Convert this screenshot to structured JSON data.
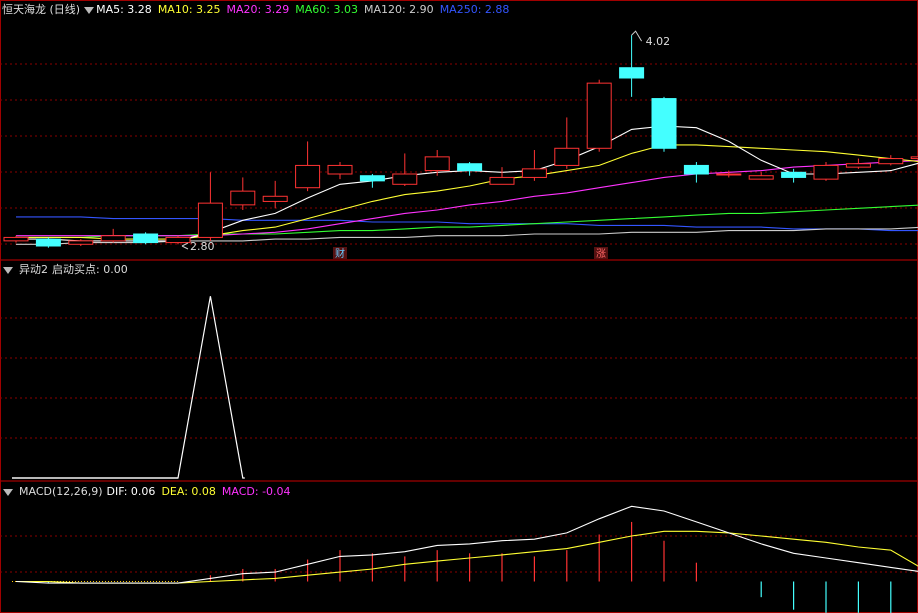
{
  "main": {
    "title": "恒天海龙 (日线)",
    "ma": [
      {
        "label": "MA5: 3.28",
        "color": "#ffffff"
      },
      {
        "label": "MA10: 3.25",
        "color": "#ffff33"
      },
      {
        "label": "MA20: 3.29",
        "color": "#ff33ff"
      },
      {
        "label": "MA60: 3.03",
        "color": "#33ff33"
      },
      {
        "label": "MA120: 2.90",
        "color": "#cccccc"
      },
      {
        "label": "MA250: 2.88",
        "color": "#3355ff"
      }
    ],
    "high_label": "4.02",
    "low_label": "2.80",
    "marker_cai": "财",
    "marker_zhang": "涨"
  },
  "pane2": {
    "title": "异动2",
    "value_label": "启动买点: 0.00"
  },
  "pane3": {
    "title": "MACD(12,26,9)",
    "dif": "DIF: 0.06",
    "dea": "DEA: 0.08",
    "macd": "MACD: -0.04"
  },
  "colors": {
    "up": "#ff3333",
    "down": "#44ffff",
    "grid": "#8a0000",
    "border": "#a00000"
  },
  "chart_data": [
    {
      "type": "candlestick",
      "title": "恒天海龙 (日线)",
      "ylim": [
        2.72,
        4.12
      ],
      "candles": [
        {
          "o": 2.82,
          "c": 2.84,
          "h": 2.85,
          "l": 2.81
        },
        {
          "o": 2.83,
          "c": 2.79,
          "h": 2.84,
          "l": 2.78
        },
        {
          "o": 2.8,
          "c": 2.82,
          "h": 2.83,
          "l": 2.79
        },
        {
          "o": 2.82,
          "c": 2.85,
          "h": 2.89,
          "l": 2.81
        },
        {
          "o": 2.86,
          "c": 2.81,
          "h": 2.87,
          "l": 2.8
        },
        {
          "o": 2.81,
          "c": 2.84,
          "h": 2.85,
          "l": 2.8
        },
        {
          "o": 2.84,
          "c": 3.04,
          "h": 3.22,
          "l": 2.82
        },
        {
          "o": 3.03,
          "c": 3.11,
          "h": 3.19,
          "l": 3.0
        },
        {
          "o": 3.05,
          "c": 3.08,
          "h": 3.17,
          "l": 3.01
        },
        {
          "o": 3.13,
          "c": 3.26,
          "h": 3.4,
          "l": 3.11
        },
        {
          "o": 3.21,
          "c": 3.26,
          "h": 3.28,
          "l": 3.18
        },
        {
          "o": 3.2,
          "c": 3.17,
          "h": 3.21,
          "l": 3.13
        },
        {
          "o": 3.15,
          "c": 3.21,
          "h": 3.33,
          "l": 3.14
        },
        {
          "o": 3.23,
          "c": 3.31,
          "h": 3.35,
          "l": 3.2
        },
        {
          "o": 3.27,
          "c": 3.23,
          "h": 3.28,
          "l": 3.2
        },
        {
          "o": 3.15,
          "c": 3.19,
          "h": 3.25,
          "l": 3.15
        },
        {
          "o": 3.19,
          "c": 3.24,
          "h": 3.35,
          "l": 3.17
        },
        {
          "o": 3.26,
          "c": 3.36,
          "h": 3.54,
          "l": 3.24
        },
        {
          "o": 3.36,
          "c": 3.74,
          "h": 3.76,
          "l": 3.34
        },
        {
          "o": 3.83,
          "c": 3.77,
          "h": 4.02,
          "l": 3.66
        },
        {
          "o": 3.65,
          "c": 3.36,
          "h": 3.66,
          "l": 3.34
        },
        {
          "o": 3.26,
          "c": 3.21,
          "h": 3.28,
          "l": 3.16
        },
        {
          "o": 3.21,
          "c": 3.21,
          "h": 3.23,
          "l": 3.19
        },
        {
          "o": 3.18,
          "c": 3.2,
          "h": 3.22,
          "l": 3.18
        },
        {
          "o": 3.22,
          "c": 3.19,
          "h": 3.24,
          "l": 3.16
        },
        {
          "o": 3.18,
          "c": 3.26,
          "h": 3.28,
          "l": 3.17
        },
        {
          "o": 3.25,
          "c": 3.27,
          "h": 3.3,
          "l": 3.24
        },
        {
          "o": 3.27,
          "c": 3.3,
          "h": 3.32,
          "l": 3.26
        },
        {
          "o": 3.3,
          "c": 3.31,
          "h": 3.34,
          "l": 3.29
        }
      ],
      "series": [
        {
          "name": "MA5",
          "values": [
            2.83,
            2.83,
            2.82,
            2.82,
            2.82,
            2.82,
            2.87,
            2.94,
            2.98,
            3.07,
            3.15,
            3.17,
            3.2,
            3.22,
            3.23,
            3.22,
            3.23,
            3.29,
            3.37,
            3.47,
            3.49,
            3.48,
            3.4,
            3.29,
            3.21,
            3.21,
            3.22,
            3.23,
            3.28
          ]
        },
        {
          "name": "MA10",
          "values": [
            2.84,
            2.84,
            2.84,
            2.83,
            2.83,
            2.83,
            2.85,
            2.88,
            2.9,
            2.95,
            3.0,
            3.05,
            3.09,
            3.11,
            3.14,
            3.18,
            3.2,
            3.23,
            3.26,
            3.33,
            3.38,
            3.38,
            3.37,
            3.36,
            3.35,
            3.34,
            3.32,
            3.3,
            3.28
          ]
        },
        {
          "name": "MA20",
          "values": [
            2.85,
            2.85,
            2.85,
            2.85,
            2.85,
            2.85,
            2.85,
            2.86,
            2.87,
            2.89,
            2.92,
            2.95,
            2.98,
            3.0,
            3.03,
            3.05,
            3.08,
            3.1,
            3.13,
            3.16,
            3.19,
            3.21,
            3.22,
            3.23,
            3.25,
            3.26,
            3.27,
            3.28,
            3.29
          ]
        },
        {
          "name": "MA60",
          "values": [
            2.84,
            2.84,
            2.84,
            2.85,
            2.85,
            2.85,
            2.86,
            2.86,
            2.86,
            2.87,
            2.88,
            2.88,
            2.89,
            2.9,
            2.9,
            2.91,
            2.92,
            2.93,
            2.94,
            2.95,
            2.96,
            2.97,
            2.98,
            2.98,
            2.99,
            3.0,
            3.01,
            3.02,
            3.03
          ]
        },
        {
          "name": "MA120",
          "values": [
            2.8,
            2.8,
            2.81,
            2.81,
            2.81,
            2.82,
            2.82,
            2.82,
            2.83,
            2.83,
            2.84,
            2.84,
            2.84,
            2.85,
            2.85,
            2.85,
            2.86,
            2.86,
            2.86,
            2.87,
            2.87,
            2.87,
            2.88,
            2.88,
            2.88,
            2.89,
            2.89,
            2.89,
            2.9
          ]
        },
        {
          "name": "MA250",
          "values": [
            2.96,
            2.96,
            2.96,
            2.95,
            2.95,
            2.95,
            2.95,
            2.94,
            2.94,
            2.94,
            2.94,
            2.93,
            2.93,
            2.93,
            2.92,
            2.92,
            2.92,
            2.92,
            2.91,
            2.91,
            2.91,
            2.9,
            2.9,
            2.9,
            2.89,
            2.89,
            2.89,
            2.88,
            2.88
          ]
        }
      ]
    },
    {
      "type": "line",
      "title": "异动2",
      "ylim": [
        0,
        1.1
      ],
      "series": [
        {
          "name": "启动买点",
          "values": [
            0,
            0,
            0,
            0,
            0,
            0,
            1,
            0,
            0,
            0,
            0,
            0,
            0,
            0,
            0,
            0,
            0,
            0,
            0,
            0,
            0,
            0,
            0,
            0,
            0,
            0,
            0,
            0,
            0
          ]
        }
      ]
    },
    {
      "type": "bar",
      "title": "MACD(12,26,9)",
      "ylim": [
        -0.15,
        0.52
      ],
      "series": [
        {
          "name": "DIF",
          "values": [
            0.0,
            -0.01,
            -0.01,
            -0.01,
            -0.01,
            -0.01,
            0.02,
            0.05,
            0.06,
            0.11,
            0.16,
            0.17,
            0.19,
            0.23,
            0.24,
            0.26,
            0.27,
            0.31,
            0.4,
            0.48,
            0.45,
            0.38,
            0.31,
            0.24,
            0.18,
            0.15,
            0.12,
            0.09,
            0.06
          ]
        },
        {
          "name": "DEA",
          "values": [
            0.0,
            0.0,
            -0.01,
            -0.01,
            -0.01,
            -0.01,
            0.0,
            0.01,
            0.02,
            0.04,
            0.06,
            0.08,
            0.11,
            0.13,
            0.15,
            0.17,
            0.19,
            0.21,
            0.25,
            0.29,
            0.32,
            0.32,
            0.31,
            0.29,
            0.27,
            0.25,
            0.22,
            0.2,
            0.08
          ]
        },
        {
          "name": "MACD",
          "values": [
            0.0,
            -0.01,
            0.0,
            0.0,
            0.0,
            0.0,
            0.04,
            0.08,
            0.08,
            0.14,
            0.2,
            0.18,
            0.16,
            0.2,
            0.18,
            0.18,
            0.16,
            0.2,
            0.3,
            0.38,
            0.26,
            0.12,
            0.0,
            -0.1,
            -0.18,
            -0.2,
            -0.2,
            -0.22,
            -0.04
          ]
        }
      ]
    }
  ]
}
